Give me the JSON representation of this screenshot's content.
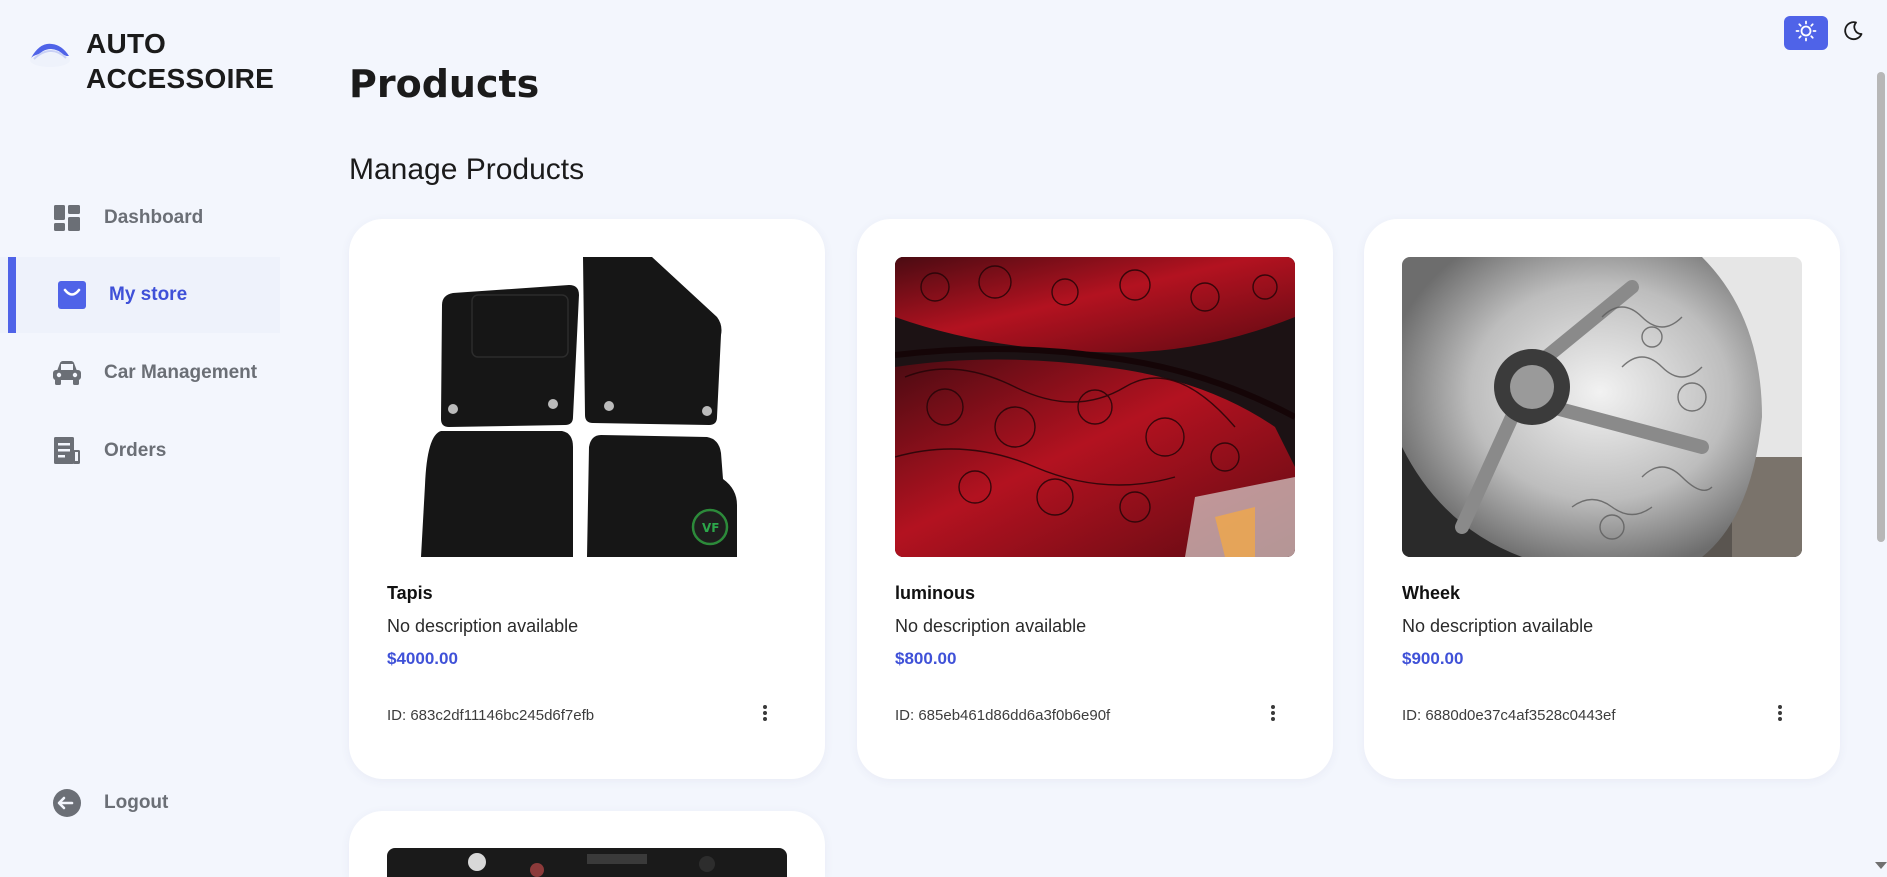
{
  "brand": {
    "line1": "AUTO",
    "line2": "ACCESSOIRE",
    "logo_icon": "car-silhouette-icon"
  },
  "colors": {
    "background": "#f3f6fd",
    "accent": "#4f63e8",
    "price": "#3f51d8",
    "nav_text": "#6b6f76"
  },
  "sidebar": {
    "items": [
      {
        "label": "Dashboard",
        "icon": "dashboard-icon",
        "active": false
      },
      {
        "label": "My store",
        "icon": "store-bag-icon",
        "active": true
      },
      {
        "label": "Car Management",
        "icon": "car-icon",
        "active": false
      },
      {
        "label": "Orders",
        "icon": "orders-icon",
        "active": false
      }
    ],
    "logout": {
      "label": "Logout",
      "icon": "logout-icon"
    }
  },
  "theme_toggle": {
    "light_icon": "sun-icon",
    "dark_icon": "moon-icon",
    "selected": "light"
  },
  "main": {
    "title": "Products",
    "section_title": "Manage Products",
    "products": [
      {
        "name": "Tapis",
        "description": "No description available",
        "price": "$4000.00",
        "id": "ID: 683c2df11146bc245d6f7efb",
        "image": "floor-mats-image"
      },
      {
        "name": "luminous",
        "description": "No description available",
        "price": "$800.00",
        "id": "ID: 685eb461d86dd6a3f0b6e90f",
        "image": "tail-light-image"
      },
      {
        "name": "Wheek",
        "description": "No description available",
        "price": "$900.00",
        "id": "ID: 6880d0e37c4af3528c0443ef",
        "image": "engraved-wheel-image"
      }
    ],
    "partial_card_image": "engine-bay-image"
  }
}
